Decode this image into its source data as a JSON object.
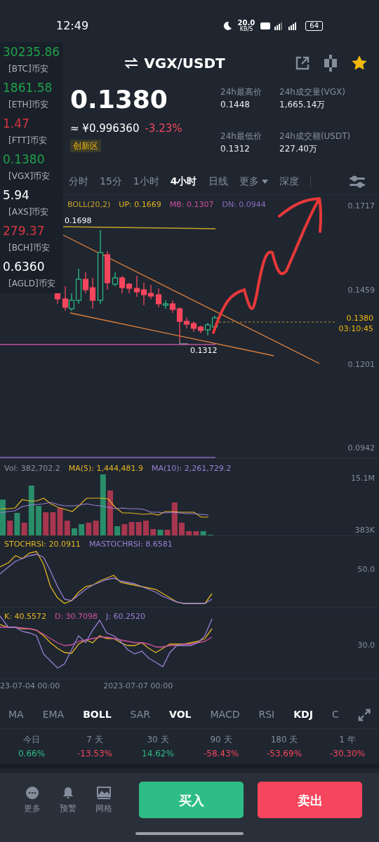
{
  "status_bar": {
    "time": "12:49",
    "net_speed": "20.0",
    "net_unit": "KB/S",
    "battery": "64"
  },
  "header": {
    "pair": "VGX/USDT",
    "favorite": true
  },
  "price": {
    "last": "0.1380",
    "fiat": "≈ ¥0.996360",
    "change": "-3.23%",
    "tag": "创新区"
  },
  "stats": [
    {
      "label": "24h最高价",
      "value": "0.1448"
    },
    {
      "label": "24h成交量(VGX)",
      "value": "1,665.14万"
    },
    {
      "label": "24h最低价",
      "value": "0.1312"
    },
    {
      "label": "24h成交额(USDT)",
      "value": "227.40万"
    }
  ],
  "intervals": [
    {
      "label": "分时",
      "selected": false,
      "kind": "tab"
    },
    {
      "label": "15分",
      "selected": false,
      "kind": "tab"
    },
    {
      "label": "1小时",
      "selected": false,
      "kind": "tab"
    },
    {
      "label": "4小时",
      "selected": true,
      "kind": "tab"
    },
    {
      "label": "日线",
      "selected": false,
      "kind": "tab"
    },
    {
      "label": "更多",
      "selected": false,
      "kind": "dropdown"
    },
    {
      "label": "深度",
      "selected": false,
      "kind": "tab"
    }
  ],
  "main_chart": {
    "legend": [
      {
        "label": "BOLL(20,2)",
        "color": "#c9a227"
      },
      {
        "label": "UP: 0.1669",
        "color": "#e6b422"
      },
      {
        "label": "MB: 0.1307",
        "color": "#d14fa0"
      },
      {
        "label": "DN: 0.0944",
        "color": "#8a6bbf"
      }
    ],
    "high_label": "0.1698",
    "low_label": "0.1312",
    "axis": [
      "0.1717",
      "0.1459",
      "0.1201",
      "0.0942"
    ],
    "last_price": "0.1380",
    "countdown": "03:10:45"
  },
  "volume": {
    "legend": [
      {
        "label": "Vol: 382,702.2",
        "color": "#8b919c"
      },
      {
        "label": "MA(5): 1,444,481.9",
        "color": "#e6b422"
      },
      {
        "label": "MA(10): 2,261,729.2",
        "color": "#9b7fd4"
      }
    ],
    "axis": [
      "15.1M",
      "383K"
    ]
  },
  "stochrsi": {
    "legend": [
      {
        "label": "STOCHRSI: 20.0911",
        "color": "#e6b422"
      },
      {
        "label": "MASTOCHRSI: 8.6581",
        "color": "#9b7fd4"
      }
    ],
    "axis": [
      "50.0"
    ]
  },
  "kdj": {
    "legend": [
      {
        "label": "K: 40.5572",
        "color": "#e6b422"
      },
      {
        "label": "D: 30.7098",
        "color": "#d14fa0"
      },
      {
        "label": "J: 60.2520",
        "color": "#9b7fd4"
      }
    ],
    "axis": [
      "30.0"
    ]
  },
  "dates": [
    "23-07-04 00:00",
    "2023-07-07 00:00"
  ],
  "indicators": [
    {
      "label": "MA",
      "selected": false
    },
    {
      "label": "EMA",
      "selected": false
    },
    {
      "label": "BOLL",
      "selected": true
    },
    {
      "label": "SAR",
      "selected": false
    },
    {
      "label": "VOL",
      "selected": true
    },
    {
      "label": "MACD",
      "selected": false
    },
    {
      "label": "RSI",
      "selected": false
    },
    {
      "label": "KDJ",
      "selected": true
    },
    {
      "label": "C",
      "selected": false
    }
  ],
  "performance": [
    {
      "period": "今日",
      "value": "0.66%",
      "color": "#2ebd85"
    },
    {
      "period": "7 天",
      "value": "-13.53%",
      "color": "#f6465d"
    },
    {
      "period": "30 天",
      "value": "14.62%",
      "color": "#2ebd85"
    },
    {
      "period": "90 天",
      "value": "-58.43%",
      "color": "#f6465d"
    },
    {
      "period": "180 天",
      "value": "-53.69%",
      "color": "#f6465d"
    },
    {
      "period": "1 年",
      "value": "-30.30%",
      "color": "#f6465d"
    }
  ],
  "bottom_bar": {
    "actions": [
      {
        "label": "更多",
        "kind": "more"
      },
      {
        "label": "预警",
        "kind": "alert"
      },
      {
        "label": "网格",
        "kind": "grid"
      }
    ],
    "buy": "买入",
    "sell": "卖出"
  },
  "ticker_overlay": [
    {
      "price": "30235.86",
      "pair": "[BTC]币安",
      "color": "#1fa24a"
    },
    {
      "price": "1861.58",
      "pair": "[ETH]币安",
      "color": "#1fa24a"
    },
    {
      "price": "1.47",
      "pair": "[FTT]币安",
      "color": "#d9363e"
    },
    {
      "price": "0.1380",
      "pair": "[VGX]币安",
      "color": "#1fa24a"
    },
    {
      "price": "5.94",
      "pair": "[AXS]币安",
      "color": "#ffffff"
    },
    {
      "price": "279.37",
      "pair": "[BCH]币安",
      "color": "#d9363e"
    },
    {
      "price": "0.6360",
      "pair": "[AGLD]币安",
      "color": "#ffffff"
    }
  ]
}
